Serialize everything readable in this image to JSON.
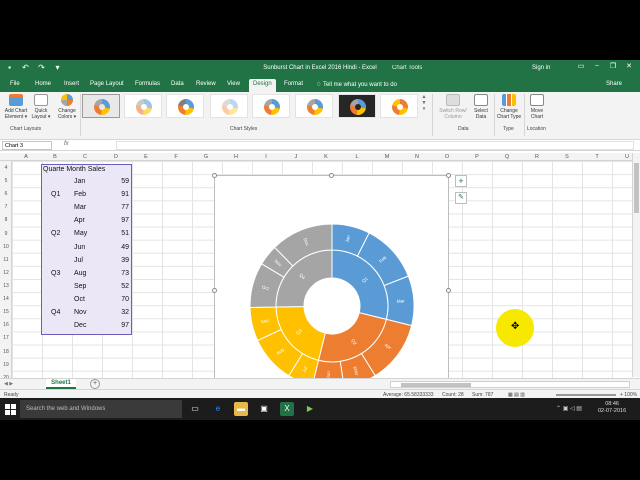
{
  "window": {
    "title": "Sunburst Chart in Excel 2016 Hindi - Excel",
    "context_tools": "Chart Tools",
    "sign_in": "Sign in",
    "share": "Share"
  },
  "tabs": [
    "File",
    "Home",
    "Insert",
    "Page Layout",
    "Formulas",
    "Data",
    "Review",
    "View",
    "Design",
    "Format"
  ],
  "active_tab": "Design",
  "tell_me": "Tell me what you want to do",
  "ribbon": {
    "add_chart_element": "Add Chart Element ▾",
    "quick_layout": "Quick Layout ▾",
    "change_colors": "Change Colors ▾",
    "chart_layouts_label": "Chart Layouts",
    "chart_styles_label": "Chart Styles",
    "switch_row_col": "Switch Row/ Column",
    "select_data": "Select Data",
    "data_label": "Data",
    "change_chart_type": "Change Chart Type",
    "type_label": "Type",
    "move_chart": "Move Chart",
    "location_label": "Location"
  },
  "formula_bar": {
    "name_box": "Chart 3",
    "fx": "fx",
    "value": ""
  },
  "columns": [
    "A",
    "B",
    "C",
    "D",
    "E",
    "F",
    "G",
    "H",
    "I",
    "J",
    "K",
    "L",
    "M",
    "N",
    "O",
    "P",
    "Q",
    "R",
    "S",
    "T",
    "U"
  ],
  "rows": [
    "4",
    "5",
    "6",
    "7",
    "8",
    "9",
    "10",
    "11",
    "12",
    "13",
    "14",
    "15",
    "16",
    "17",
    "18",
    "19",
    "20"
  ],
  "table": {
    "header": "Quarte Month Sales",
    "quarters": [
      "Q1",
      "Q2",
      "Q3",
      "Q4"
    ],
    "months": [
      "Jan",
      "Feb",
      "Mar",
      "Apr",
      "May",
      "Jun",
      "Jul",
      "Aug",
      "Sep",
      "Oct",
      "Nov",
      "Dec"
    ],
    "sales": [
      "59",
      "91",
      "77",
      "97",
      "51",
      "49",
      "39",
      "73",
      "52",
      "70",
      "32",
      "97"
    ]
  },
  "chart_data": {
    "type": "sunburst",
    "levels": [
      "Quarter",
      "Month"
    ],
    "categories": [
      "Jan",
      "Feb",
      "Mar",
      "Apr",
      "May",
      "Jun",
      "Jul",
      "Aug",
      "Sep",
      "Oct",
      "Nov",
      "Dec"
    ],
    "values": [
      59,
      91,
      77,
      97,
      51,
      49,
      39,
      73,
      52,
      70,
      32,
      97
    ],
    "groups": [
      {
        "name": "Q1",
        "months": [
          "Jan",
          "Feb",
          "Mar"
        ],
        "total": 227,
        "color": "#5b9bd5"
      },
      {
        "name": "Q2",
        "months": [
          "Apr",
          "May",
          "Jun"
        ],
        "total": 197,
        "color": "#ed7d31"
      },
      {
        "name": "Q3",
        "months": [
          "Jul",
          "Aug",
          "Sep"
        ],
        "total": 164,
        "color": "#ffc000"
      },
      {
        "name": "Q4",
        "months": [
          "Oct",
          "Nov",
          "Dec"
        ],
        "total": 199,
        "color": "#a5a5a5"
      }
    ],
    "title": ""
  },
  "sheet": {
    "tab": "Sheet1",
    "add": "+"
  },
  "status": {
    "ready": "Ready",
    "average": "Average: 65.58333333",
    "count": "Count: 28",
    "sum": "Sum: 787",
    "zoom": "+ 100%"
  },
  "taskbar": {
    "search": "Search the web and Windows",
    "time": "08:46",
    "date": "02-07-2016"
  },
  "colors": {
    "excel_green": "#217346",
    "q1": "#5b9bd5",
    "q2": "#ed7d31",
    "q3": "#ffc000",
    "q4": "#a5a5a5",
    "selection_fill": "#ece7f6",
    "cursor_highlight": "#f7e800"
  },
  "icons": [
    "undo-icon",
    "redo-icon",
    "save-icon",
    "minimize-icon",
    "maximize-icon",
    "close-icon",
    "plus-icon",
    "brush-icon",
    "lightbulb-icon",
    "windows-start-icon"
  ]
}
